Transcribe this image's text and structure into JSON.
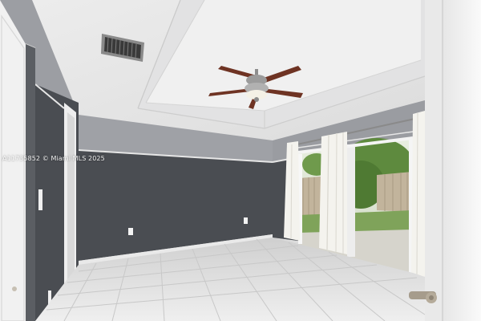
{
  "watermark": {
    "text": "A11735852 © Miami MLS 2025"
  },
  "colors": {
    "wall_lower": "#4a4d52",
    "wall_upper": "#9a9ca1",
    "ceiling": "#e9e9ea",
    "floor": "#e3e3e3",
    "door": "#f2f2f2",
    "grass": "#7fa35a",
    "fence": "#c2b49c",
    "curtain": "#f4f3ee",
    "fan_blade": "#6e3323"
  },
  "icons": [
    "ceiling-fan-icon",
    "air-vent-icon",
    "door-handle-icon"
  ]
}
